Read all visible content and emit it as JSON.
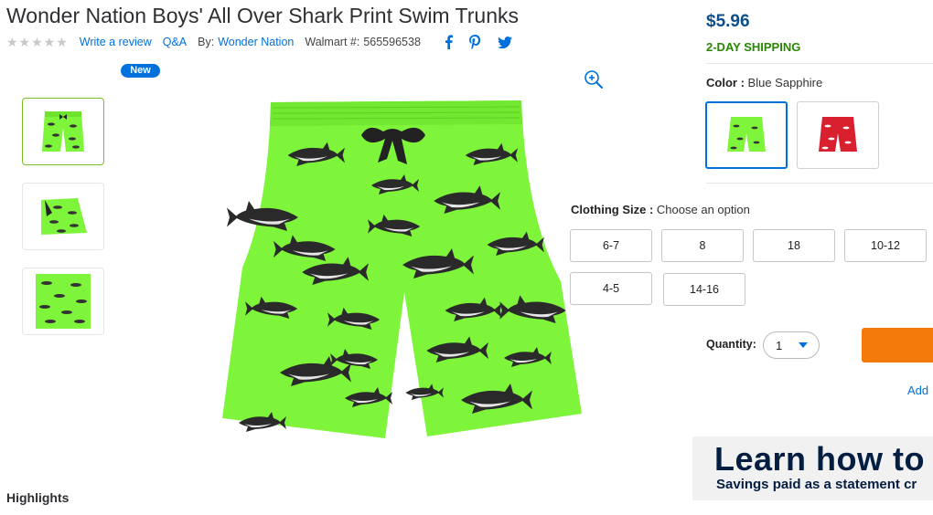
{
  "product": {
    "title": "Wonder Nation Boys' All Over Shark Print Swim Trunks",
    "rating_stars": "★★★★★",
    "write_review": "Write a review",
    "qa": "Q&A",
    "by_label": "By:",
    "brand": "Wonder Nation",
    "walmart_number_label": "Walmart #:",
    "walmart_number": "565596538",
    "new_badge": "New"
  },
  "social": {
    "icons": [
      "facebook-icon",
      "pinterest-icon",
      "twitter-icon"
    ],
    "color": "#0071dc"
  },
  "gallery": {
    "thumbnails": [
      "front view",
      "folded view",
      "pattern detail"
    ],
    "selected_index": 0,
    "zoom_icon": "zoom-in-icon"
  },
  "pricing": {
    "price": "$5.96",
    "shipping": "2-DAY SHIPPING",
    "price_color": "#0b4f8c",
    "shipping_color": "#2a8703"
  },
  "color_option": {
    "label": "Color",
    "value": "Blue Sapphire",
    "swatches": [
      {
        "name": "green shark print",
        "color": "#7ef53a",
        "selected": true
      },
      {
        "name": "red shark print",
        "color": "#d8202f",
        "selected": false
      }
    ]
  },
  "size_option": {
    "label": "Clothing Size",
    "value": "Choose an option",
    "sizes": [
      "6-7",
      "8",
      "18",
      "10-12",
      "4-5",
      "14-16"
    ]
  },
  "quantity": {
    "label": "Quantity:",
    "value": "1"
  },
  "actions": {
    "add_link": "Add",
    "button_color": "#f47a0c"
  },
  "promo": {
    "headline": "Learn how to s",
    "subline": "Savings paid as a statement cr"
  },
  "section": {
    "highlights": "Highlights"
  }
}
